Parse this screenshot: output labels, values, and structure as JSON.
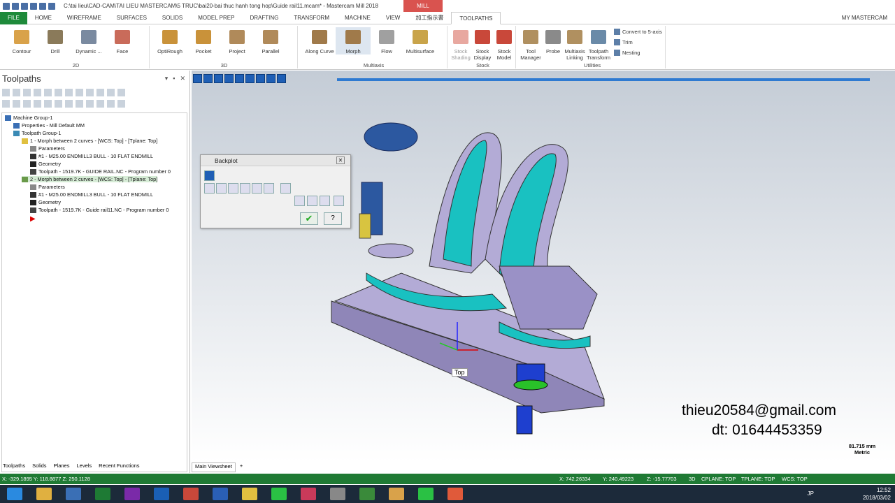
{
  "window": {
    "title": "C:\\tai lieu\\CAD-CAM\\TAI LIEU MASTERCAM\\5 TRUC\\bai20-bai thuc hanh tong hop\\Guide rail11.mcam* - Mastercam Mill 2018",
    "context_tab": "MILL"
  },
  "tabs": [
    "FILE",
    "HOME",
    "WIREFRAME",
    "SURFACES",
    "SOLIDS",
    "MODEL PREP",
    "DRAFTING",
    "TRANSFORM",
    "MACHINE",
    "VIEW",
    "加工指示書",
    "TOOLPATHS"
  ],
  "tabs_right": "MY MASTERCAM",
  "ribbon": {
    "g2d": {
      "label": "2D",
      "items": [
        "Contour",
        "Drill",
        "Dynamic ...",
        "Face"
      ]
    },
    "g3d": {
      "label": "3D",
      "items": [
        "OptiRough",
        "Pocket",
        "Project",
        "Parallel"
      ]
    },
    "gmulti": {
      "label": "Multiaxis",
      "items": [
        "Along Curve",
        "Morph",
        "Flow",
        "Multisurface"
      ]
    },
    "gstock": {
      "label": "Stock",
      "items": [
        "Stock Shading",
        "Stock Display",
        "Stock Model"
      ]
    },
    "gutil": {
      "label": "Utilities",
      "items": [
        "Tool Manager",
        "Probe",
        "Multiaxis Linking",
        "Toolpath Transform"
      ],
      "small": [
        "Convert to 5-axis",
        "Trim",
        "Nesting"
      ]
    }
  },
  "left_panel": {
    "title": "Toolpaths",
    "tree": [
      "Machine Group-1",
      "Properties - Mill Default MM",
      "Toolpath Group-1",
      "1 - Morph between 2 curves - [WCS: Top] - [Tplane: Top]",
      "Parameters",
      "#1 - M25.00 ENDMILL3 BULL - 10 FLAT ENDMILL",
      "Geometry",
      "Toolpath - 1519.7K - GUIDE RAIL.NC - Program number 0",
      "2 - Morph between 2 curves - [WCS: Top] - [Tplane: Top]",
      "Parameters",
      "#1 - M25.00 ENDMILL3 BULL - 10 FLAT ENDMILL",
      "Geometry",
      "Toolpath - 1519.7K - Guide rail11.NC - Program number 0"
    ],
    "bottom_tabs": [
      "Toolpaths",
      "Solids",
      "Planes",
      "Levels",
      "Recent Functions"
    ]
  },
  "backplot": {
    "title": "Backplot"
  },
  "viewport": {
    "view_label": "Top",
    "overlay_email": "thieu20584@gmail.com",
    "overlay_phone": "dt: 01644453359",
    "scale_value": "81.715 mm",
    "scale_unit": "Metric",
    "viewsheet_tab": "Main Viewsheet"
  },
  "status": {
    "coords_left": "X: -329.1895   Y: 118.8877   Z: 250.1128",
    "x": "X:  742.26334",
    "y": "Y:  240.49223",
    "z": "Z:  -15.77703",
    "mode": "3D",
    "cplane": "CPLANE: TOP",
    "tplane": "TPLANE: TOP",
    "wcs": "WCS: TOP"
  },
  "taskbar": {
    "time": "12:52",
    "date": "2018/03/02",
    "lang": "JP"
  }
}
